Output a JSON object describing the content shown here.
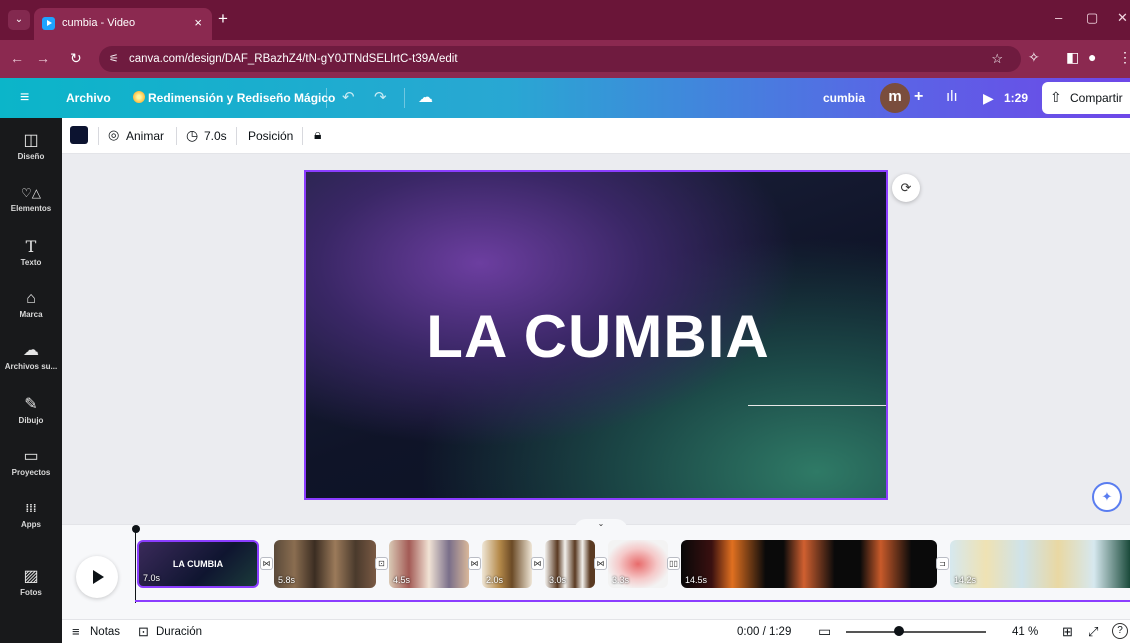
{
  "browser": {
    "tab_title": "cumbia - Video",
    "tab_close": "×",
    "new_tab": "+",
    "url": "canva.com/design/DAF_RBazhZ4/tN-gY0JTNdSELlrtC-t39A/edit",
    "win_min": "–",
    "win_max": "▢",
    "win_close": "✕"
  },
  "header": {
    "menu_icon": "≡",
    "archivo": "Archivo",
    "magic_label": "Redimensión y Rediseño Mágico",
    "design_name": "cumbia",
    "avatar_letter": "m",
    "add": "+",
    "duration": "1:29",
    "share": "Compartir"
  },
  "sidebar": {
    "items": [
      {
        "label": "Diseño",
        "icon": "◫"
      },
      {
        "label": "Elementos",
        "icon": "♡△"
      },
      {
        "label": "Texto",
        "icon": "T"
      },
      {
        "label": "Marca",
        "icon": "⌂"
      },
      {
        "label": "Archivos su...",
        "icon": "☁"
      },
      {
        "label": "Dibujo",
        "icon": "✎"
      },
      {
        "label": "Proyectos",
        "icon": "▭"
      },
      {
        "label": "Apps",
        "icon": "⁞⁞⁞"
      },
      {
        "label": "Fotos",
        "icon": "▨"
      }
    ]
  },
  "toolbar": {
    "animate": "Animar",
    "duration": "7.0s",
    "position": "Posición"
  },
  "slide": {
    "title": "LA CUMBIA"
  },
  "timeline": {
    "clips": [
      {
        "duration": "7.0s",
        "label": "LA CUMBIA"
      },
      {
        "duration": "5.8s"
      },
      {
        "duration": "4.5s"
      },
      {
        "duration": "2.0s"
      },
      {
        "duration": "3.0s"
      },
      {
        "duration": "3.3s"
      },
      {
        "duration": "14.5s"
      },
      {
        "duration": "14.2s"
      }
    ]
  },
  "footer": {
    "notes": "Notas",
    "duration": "Duración",
    "time": "0:00 / 1:29",
    "zoom": "41 %",
    "zoom_level": 0.41,
    "help": "?"
  },
  "colors": {
    "accent": "#8b3dff",
    "chrome": "#8b2950"
  }
}
